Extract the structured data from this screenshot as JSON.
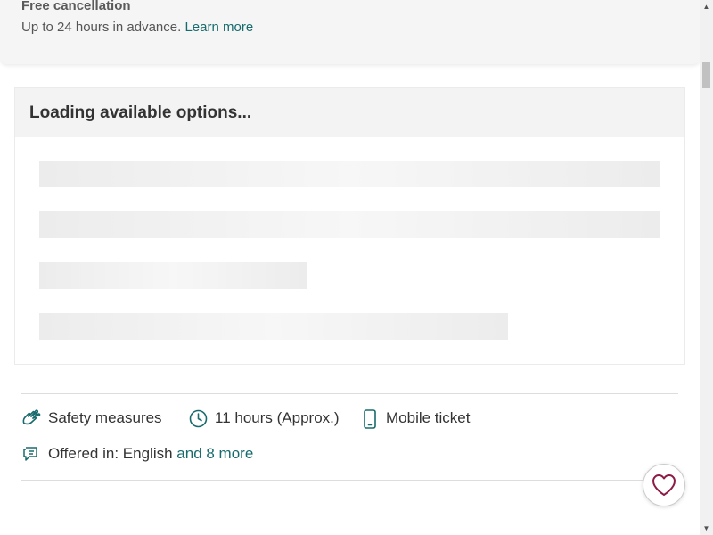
{
  "cancellation": {
    "title": "Free cancellation",
    "description": "Up to 24 hours in advance.",
    "learn_more": "Learn more"
  },
  "options": {
    "loading_text": "Loading available options..."
  },
  "features": {
    "safety_label": "Safety measures",
    "duration_label": "11 hours (Approx.)",
    "ticket_label": "Mobile ticket",
    "language_prefix": "Offered in: English",
    "language_more": "and 8 more"
  },
  "icons": {
    "safety": "hands-clean-icon",
    "duration": "clock-icon",
    "ticket": "phone-icon",
    "language": "speech-bubble-icon",
    "wishlist": "heart-icon"
  },
  "colors": {
    "accent": "#186b6d",
    "heart": "#8c1b45"
  }
}
